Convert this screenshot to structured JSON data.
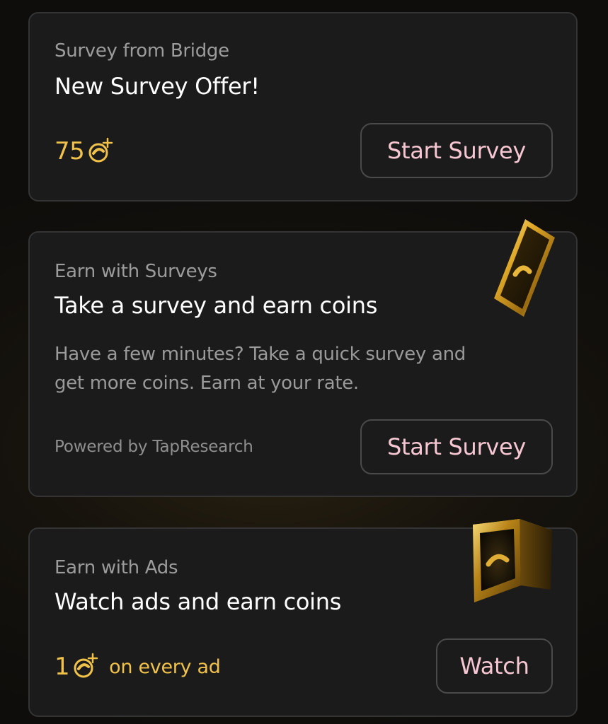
{
  "cards": [
    {
      "eyebrow": "Survey from Bridge",
      "title": "New Survey Offer!",
      "reward": "75",
      "button": "Start Survey"
    },
    {
      "eyebrow": "Earn with Surveys",
      "title": "Take a survey and earn coins",
      "description_line1": "Have a few minutes? Take a quick survey and",
      "description_line2": "get more coins. Earn at your rate.",
      "powered_by": "Powered by TapResearch",
      "button": "Start Survey",
      "art_icon": "gold-phone-icon"
    },
    {
      "eyebrow": "Earn with Ads",
      "title": "Watch ads and earn coins",
      "reward": "1",
      "reward_suffix": "on every ad",
      "button": "Watch",
      "art_icon": "gold-tv-icon"
    }
  ],
  "colors": {
    "background": "#0e0d0b",
    "card": "#1b1b1b",
    "card_border": "#343434",
    "accent_gold": "#f1c24a",
    "button_text": "#f6c7d3",
    "muted_text": "#9c9c9c"
  },
  "icons": {
    "coin": "coin-plus-icon"
  }
}
